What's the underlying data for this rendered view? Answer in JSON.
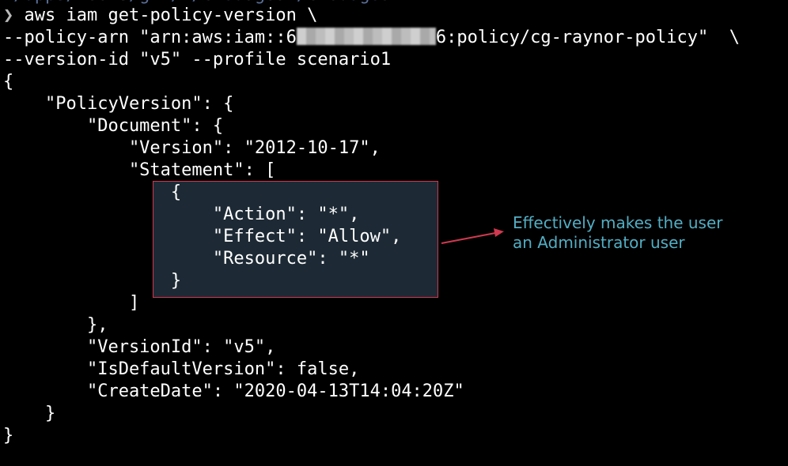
{
  "terminal": {
    "previous_line": "~/dpps/tools/git/…/cloudgoat/cloudgoat",
    "prompt_symbol": "❯",
    "command": {
      "line1": "aws iam get-policy-version \\",
      "line2_prefix": "--policy-arn \"arn:aws:iam::6",
      "line2_suffix": "6:policy/cg-raynor-policy\"  \\",
      "line3": "--version-id \"v5\" --profile scenario1"
    },
    "output_lines": [
      "{",
      "    \"PolicyVersion\": {",
      "        \"Document\": {",
      "            \"Version\": \"2012-10-17\",",
      "            \"Statement\": [",
      "                {",
      "                    \"Action\": \"*\",",
      "                    \"Effect\": \"Allow\",",
      "                    \"Resource\": \"*\"",
      "                }",
      "            ]",
      "        },",
      "        \"VersionId\": \"v5\",",
      "        \"IsDefaultVersion\": false,",
      "        \"CreateDate\": \"2020-04-13T14:04:20Z\"",
      "    }",
      "}"
    ]
  },
  "annotation": {
    "line1": "Effectively makes the user",
    "line2": "an Administrator user"
  },
  "colors": {
    "background": "#000000",
    "text": "#ffffff",
    "highlight_fill": "#1d2a35",
    "highlight_border": "#d0394f",
    "annotation_text": "#52aec4",
    "arrow": "#d0394f"
  }
}
